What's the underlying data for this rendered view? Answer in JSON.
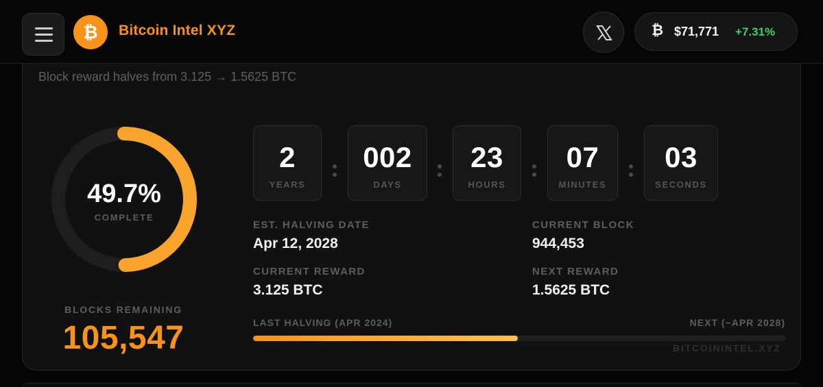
{
  "header": {
    "brand": "Bitcoin Intel XYZ",
    "price": "$71,771",
    "price_symbol": "₿",
    "change": "+7.31%",
    "icons": [
      "menu-icon",
      "bitcoin-logo",
      "x-social-icon"
    ],
    "accent_color": "#f7931a",
    "positive_color": "#3ecf6a"
  },
  "card": {
    "subtitle": "Block reward halves from 3.125 → 1.5625 BTC",
    "progress": {
      "percent_text": "49.7%",
      "percent_value": 49.7,
      "label": "COMPLETE"
    },
    "blocks_remaining": {
      "label": "BLOCKS REMAINING",
      "value": "105,547"
    },
    "countdown": [
      {
        "value": "2",
        "unit": "YEARS"
      },
      {
        "value": "002",
        "unit": "DAYS"
      },
      {
        "value": "23",
        "unit": "HOURS"
      },
      {
        "value": "07",
        "unit": "MINUTES"
      },
      {
        "value": "03",
        "unit": "SECONDS"
      }
    ],
    "info": {
      "est_date_label": "EST. HALVING DATE",
      "est_date_value": "Apr 12, 2028",
      "current_block_label": "CURRENT BLOCK",
      "current_block_value": "944,453",
      "current_reward_label": "CURRENT REWARD",
      "current_reward_value": "3.125 BTC",
      "next_reward_label": "NEXT REWARD",
      "next_reward_value": "1.5625 BTC"
    },
    "timeline": {
      "left_label": "LAST HALVING (APR 2024)",
      "right_label": "NEXT (~APR 2028)",
      "fill_fraction": 0.497
    },
    "watermark": "BITCOININTEL.XYZ"
  }
}
